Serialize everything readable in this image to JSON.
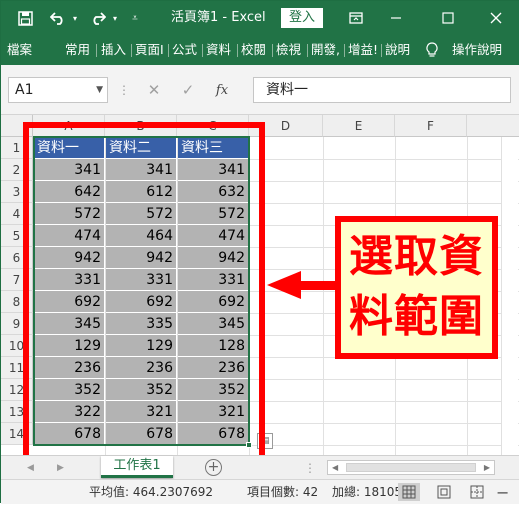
{
  "titlebar": {
    "title": "活頁簿1 - Excel",
    "signin": "登入"
  },
  "ribbon": {
    "tabs": [
      "檔案",
      "常用",
      "插入",
      "頁面I",
      "公式",
      "資料",
      "校閱",
      "檢視",
      "開發,",
      "增益!",
      "說明",
      "操作說明"
    ]
  },
  "formula": {
    "namebox": "A1",
    "content": "資料一"
  },
  "columns": [
    "A",
    "B",
    "C",
    "D",
    "E",
    "F"
  ],
  "rows": [
    "1",
    "2",
    "3",
    "4",
    "5",
    "6",
    "7",
    "8",
    "9",
    "10",
    "11",
    "12",
    "13",
    "14"
  ],
  "table": {
    "headers": [
      "資料一",
      "資料二",
      "資料三"
    ],
    "values": [
      [
        341,
        341,
        341
      ],
      [
        642,
        612,
        632
      ],
      [
        572,
        572,
        572
      ],
      [
        474,
        464,
        474
      ],
      [
        942,
        942,
        942
      ],
      [
        331,
        331,
        331
      ],
      [
        692,
        692,
        692
      ],
      [
        345,
        335,
        345
      ],
      [
        129,
        129,
        128
      ],
      [
        236,
        236,
        236
      ],
      [
        352,
        352,
        352
      ],
      [
        322,
        321,
        321
      ],
      [
        678,
        678,
        678
      ]
    ]
  },
  "callout": {
    "line1": "選取資",
    "line2": "料範圍"
  },
  "sheets": {
    "active": "工作表1"
  },
  "status": {
    "average": "平均值: 464.2307692",
    "count": "項目個數: 42",
    "sum": "加總: 18105"
  },
  "colors": {
    "accent": "#217346",
    "header_fill": "#3860a8",
    "selection_fill": "#b3b3b3",
    "annotation": "#ff0000",
    "callout_bg": "#ffffcc"
  }
}
